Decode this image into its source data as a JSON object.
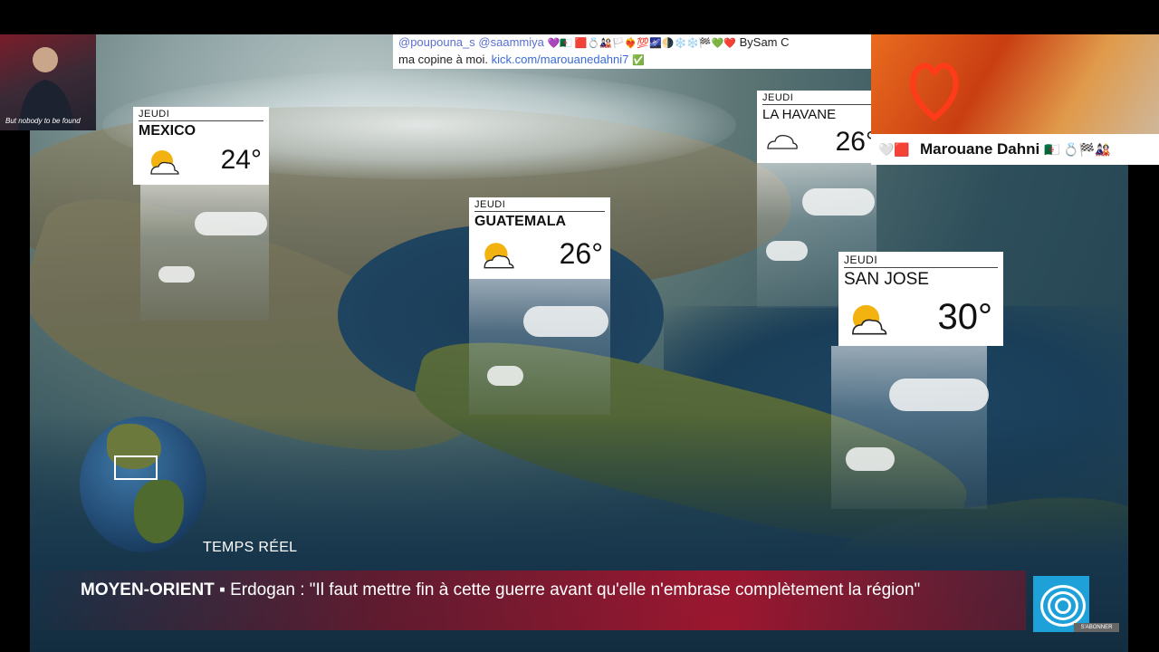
{
  "tweet": {
    "handle1": "@poupouna_s",
    "handle2": "@saammiya",
    "emojis": "💜🇩🇿 🟥💍🎎🏳️❤️‍🔥💯🌌🌗❄️❄️🏁💚❤️",
    "by": "BySam C",
    "line2_text": "ma copine à moi.",
    "line2_link": "kick.com/marouanedahni7",
    "verified": "✅"
  },
  "cam_left": {
    "caption": "But nobody to be found"
  },
  "name_bar": {
    "name": "Marouane Dahni",
    "prefix_emoji": "🤍🟥",
    "suffix_emoji": "🇩🇿 💍🏁🎎"
  },
  "weather": [
    {
      "day": "JEUDI",
      "city": "MEXICO",
      "temp": "24°",
      "icon": "sun-behind-cloud-icon"
    },
    {
      "day": "JEUDI",
      "city": "GUATEMALA",
      "temp": "26°",
      "icon": "sun-behind-cloud-icon"
    },
    {
      "day": "JEUDI",
      "city": "LA HAVANE",
      "temp": "26°",
      "icon": "cloud-icon"
    },
    {
      "day": "JEUDI",
      "city": "SAN JOSE",
      "temp": "30°",
      "icon": "sun-behind-cloud-icon"
    }
  ],
  "realtime": "TEMPS RÉEL",
  "ticker": {
    "tag": "MOYEN-ORIENT",
    "separator": "▪",
    "headline": "Erdogan : \"Il faut mettre fin à cette guerre avant qu'elle n'embrase complètement la région\""
  },
  "subscribe": "S'ABONNER",
  "colors": {
    "ticker_red": "#b01530",
    "logo_blue": "#1ea0d9",
    "link_blue": "#3a6bd6"
  }
}
